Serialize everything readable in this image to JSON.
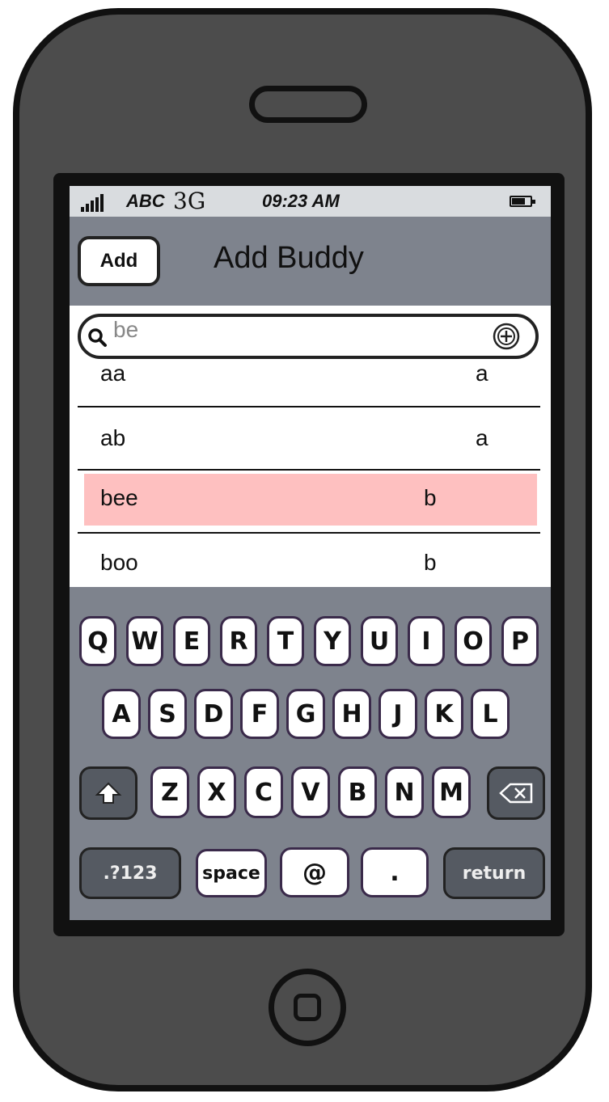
{
  "status_bar": {
    "carrier": "ABC",
    "network": "3G",
    "time": "09:23 AM"
  },
  "nav": {
    "add_label": "Add",
    "title": "Add Buddy"
  },
  "search": {
    "value": "be"
  },
  "list": {
    "rows": [
      {
        "name": "aa",
        "initial": "a"
      },
      {
        "name": "ab",
        "initial": "a"
      },
      {
        "name": "bee",
        "initial": "b",
        "selected": true
      },
      {
        "name": "boo",
        "initial": "b"
      }
    ]
  },
  "keyboard": {
    "row1": [
      "Q",
      "W",
      "E",
      "R",
      "T",
      "Y",
      "U",
      "I",
      "O",
      "P"
    ],
    "row2": [
      "A",
      "S",
      "D",
      "F",
      "G",
      "H",
      "J",
      "K",
      "L"
    ],
    "row3": [
      "Z",
      "X",
      "C",
      "V",
      "B",
      "N",
      "M"
    ],
    "row4": {
      "numbers": ".?123",
      "space": "space",
      "at": "@",
      "dot": ".",
      "return": "return"
    }
  },
  "colors": {
    "selected_row": "#fec0c0",
    "bar": "#7e838d",
    "phone_body": "#4c4c4c"
  }
}
